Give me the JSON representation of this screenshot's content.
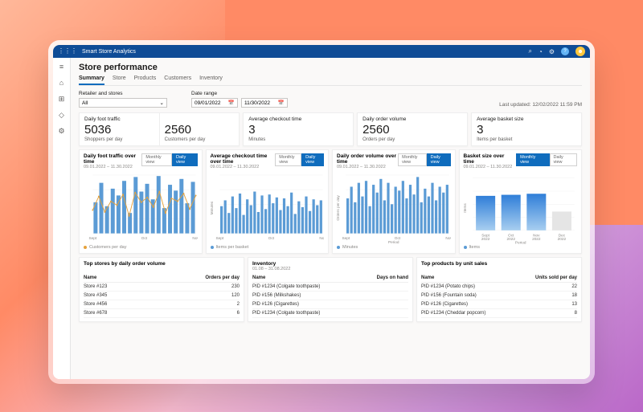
{
  "app": {
    "title": "Smart Store Analytics"
  },
  "header_icons": [
    "search-icon",
    "bell-icon",
    "settings-gear-icon",
    "help-icon",
    "avatar"
  ],
  "sidebar": {
    "items": [
      {
        "name": "menu-icon",
        "glyph": "≡"
      },
      {
        "name": "home-icon",
        "glyph": "⌂"
      },
      {
        "name": "retail-icon",
        "glyph": "⊞"
      },
      {
        "name": "lightbulb-icon",
        "glyph": "◇"
      },
      {
        "name": "settings-icon",
        "glyph": "⚙"
      }
    ]
  },
  "page": {
    "title": "Store performance",
    "tabs": [
      "Summary",
      "Store",
      "Products",
      "Customers",
      "Inventory"
    ],
    "active_tab": 0,
    "last_updated_label": "Last updated:",
    "last_updated_value": "12/02/2022 11:59  PM"
  },
  "filters": {
    "retailer_label": "Retailer and stores",
    "retailer_value": "All",
    "date_label": "Date range",
    "date_from": "09/01/2022",
    "date_to": "11/30/2022"
  },
  "kpis": {
    "foot_traffic": {
      "label": "Daily foot traffic",
      "value": "5036",
      "sub": "Shoppers per day"
    },
    "customers": {
      "value": "2560",
      "sub": "Customers per day"
    },
    "checkout": {
      "label": "Average checkout time",
      "value": "3",
      "sub": "Minutes"
    },
    "orders": {
      "label": "Daily order volume",
      "value": "2560",
      "sub": "Orders per day"
    },
    "basket": {
      "label": "Average basket size",
      "value": "3",
      "sub": "Items per basket"
    }
  },
  "charts_meta": {
    "range_sub": "09.01.2022 – 11.30.2022",
    "chart1": {
      "title": "Daily foot traffic over time",
      "legend": "Customers per day",
      "monthly_label": "Monthly view",
      "daily_label": "Daily view"
    },
    "chart2": {
      "title": "Average checkout time over time",
      "legend": "Items per basket",
      "monthly_label": "Monthly view",
      "daily_label": "Daily view"
    },
    "chart3": {
      "title": "Daily order volume over time",
      "legend": "Minutes",
      "monthly_label": "Monthly view",
      "daily_label": "Daily view"
    },
    "chart4": {
      "title": "Basket size over time",
      "legend": "Items",
      "monthly_label": "Monthly view",
      "daily_label": "Daily view"
    }
  },
  "chart_data": [
    {
      "type": "bar",
      "title": "Daily foot traffic over time",
      "xlabel": "",
      "ylabel": "",
      "ylim": [
        0,
        6000
      ],
      "categories": [
        "Sept",
        "",
        "",
        "",
        "Oct",
        "",
        "",
        "",
        "Nov"
      ],
      "series": [
        {
          "name": "Shoppers",
          "values": [
            3200,
            5200,
            2800,
            4600,
            3900,
            5400,
            2100,
            5800,
            4300,
            5100,
            3500,
            5900,
            2600,
            5000,
            4400,
            5600,
            3100,
            5300
          ]
        },
        {
          "name": "Customers per day (line)",
          "values": [
            2400,
            3800,
            2200,
            3300,
            2900,
            4000,
            1800,
            4200,
            3200,
            3700,
            2700,
            4300,
            2100,
            3600,
            3300,
            4100,
            2500,
            3900
          ]
        }
      ]
    },
    {
      "type": "bar",
      "title": "Average checkout time over time",
      "xlabel": "",
      "ylabel": "Minutes",
      "ylim": [
        0,
        6
      ],
      "categories": [
        "Sept",
        "",
        "",
        "",
        "Oct",
        "",
        "",
        "",
        "Nov"
      ],
      "values": [
        2.8,
        3.4,
        2.1,
        3.8,
        2.6,
        4.1,
        1.9,
        3.5,
        2.9,
        4.3,
        2.2,
        3.9,
        2.5,
        4.0,
        3.1,
        3.7,
        2.4,
        3.6,
        2.8,
        4.2,
        2.0,
        3.3,
        2.7,
        3.8,
        2.3,
        3.5,
        2.9,
        3.4
      ]
    },
    {
      "type": "bar",
      "title": "Daily order volume over time",
      "xlabel": "Period",
      "ylabel": "Orders per day",
      "ylim": [
        0,
        3000
      ],
      "categories": [
        "Sept",
        "",
        "",
        "",
        "Oct",
        "",
        "",
        "",
        "Nov"
      ],
      "values": [
        1800,
        2400,
        1600,
        2600,
        1900,
        2700,
        1400,
        2500,
        2100,
        2800,
        1700,
        2600,
        1500,
        2400,
        2200,
        2700,
        1800,
        2500,
        2000,
        2900,
        1600,
        2300,
        1900,
        2600,
        1700,
        2400,
        2100,
        2500
      ]
    },
    {
      "type": "bar",
      "title": "Basket size over time",
      "xlabel": "Period",
      "ylabel": "Items",
      "ylim": [
        0,
        5
      ],
      "categories": [
        "Sept 2022",
        "Oct 2022",
        "Nov 2022",
        "Dec 2022"
      ],
      "values": [
        3.3,
        3.4,
        3.5,
        1.8
      ]
    }
  ],
  "tables": {
    "top_stores": {
      "title": "Top stores by daily order volume",
      "sub": "",
      "columns": [
        "Name",
        "Orders per day"
      ],
      "rows": [
        [
          "Store #123",
          "230"
        ],
        [
          "Store #345",
          "120"
        ],
        [
          "Store #456",
          "2"
        ],
        [
          "Store #678",
          "6"
        ]
      ]
    },
    "inventory": {
      "title": "Inventory",
      "sub": "01.08 – 31.08.2022",
      "columns": [
        "Name",
        "Days on hand"
      ],
      "rows": [
        [
          "PID #1234 (Colgate toothpaste)",
          ""
        ],
        [
          "PID #156 (Milkshakes)",
          ""
        ],
        [
          "PID #126 (Cigarettes)",
          ""
        ],
        [
          "PID #1234 (Colgate toothpaste)",
          ""
        ]
      ]
    },
    "top_products": {
      "title": "Top products by unit sales",
      "sub": "",
      "columns": [
        "Name",
        "Units sold per day"
      ],
      "rows": [
        [
          "PID #1234 (Potato chips)",
          "22"
        ],
        [
          "PID #156 (Fountain soda)",
          "18"
        ],
        [
          "PID #126 (Cigarettes)",
          "13"
        ],
        [
          "PID #1234 (Cheddar popcorn)",
          "8"
        ]
      ]
    }
  }
}
